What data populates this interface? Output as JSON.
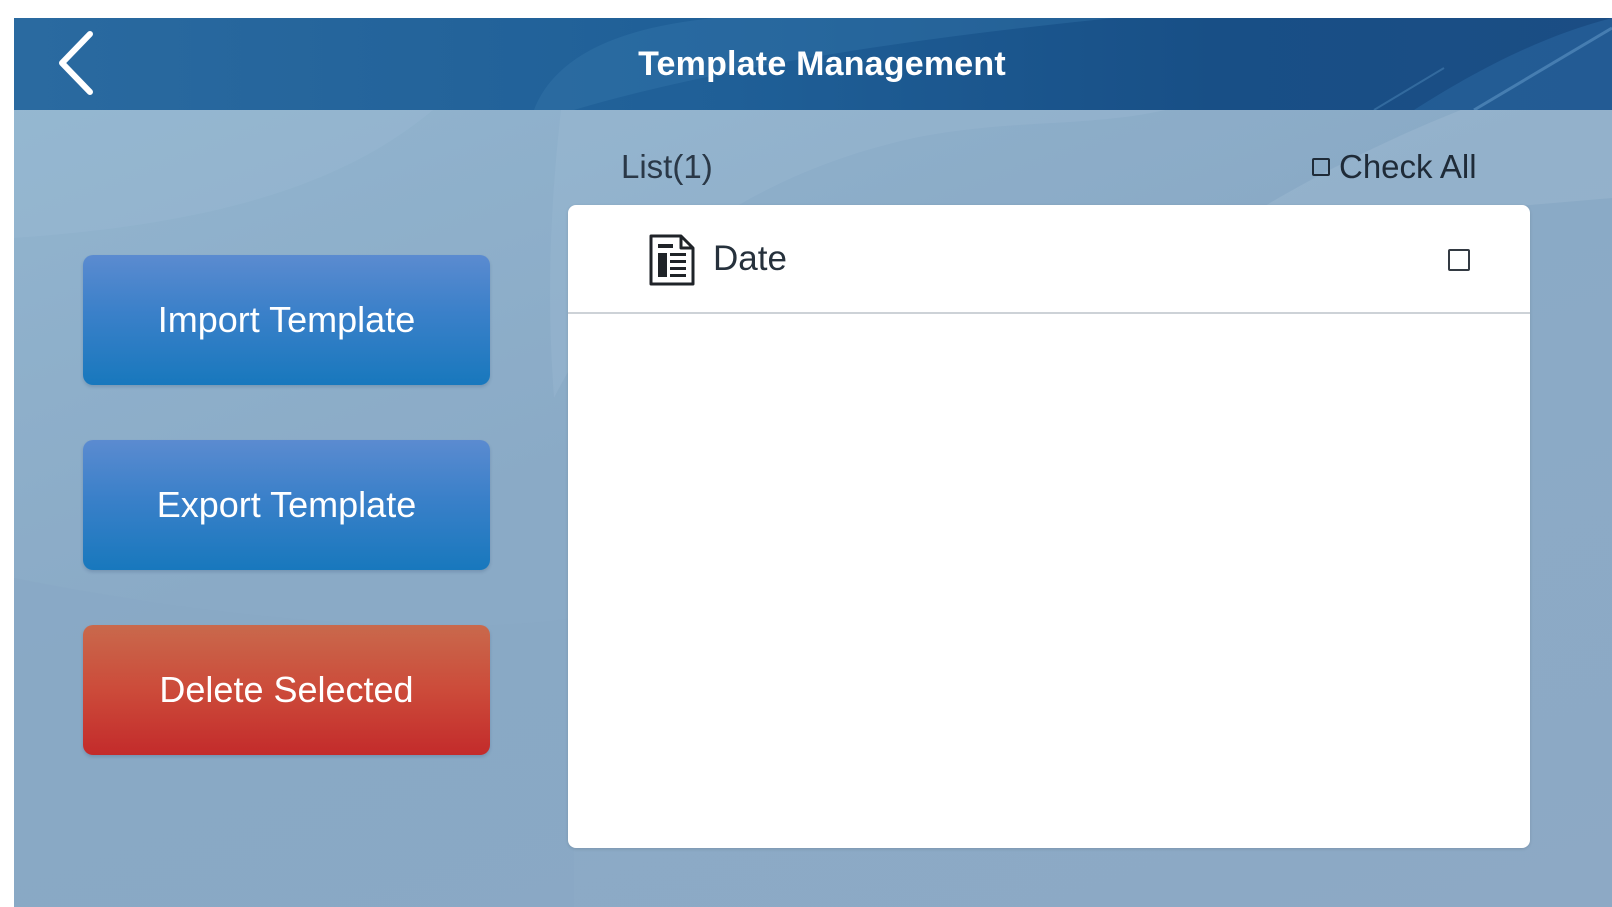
{
  "header": {
    "title": "Template Management",
    "back_icon": "chevron-left-icon"
  },
  "actions": {
    "import_label": "Import Template",
    "export_label": "Export Template",
    "delete_label": "Delete Selected"
  },
  "list": {
    "label": "List(1)",
    "check_all_label": "Check All",
    "check_all_checked": false,
    "items": [
      {
        "name": "Date",
        "icon": "document-icon",
        "checked": false
      }
    ]
  },
  "colors": {
    "header": "#1f5f97",
    "primary_button": "#3a80c9",
    "danger_button": "#cc4b3a",
    "background": "#8daac6"
  }
}
